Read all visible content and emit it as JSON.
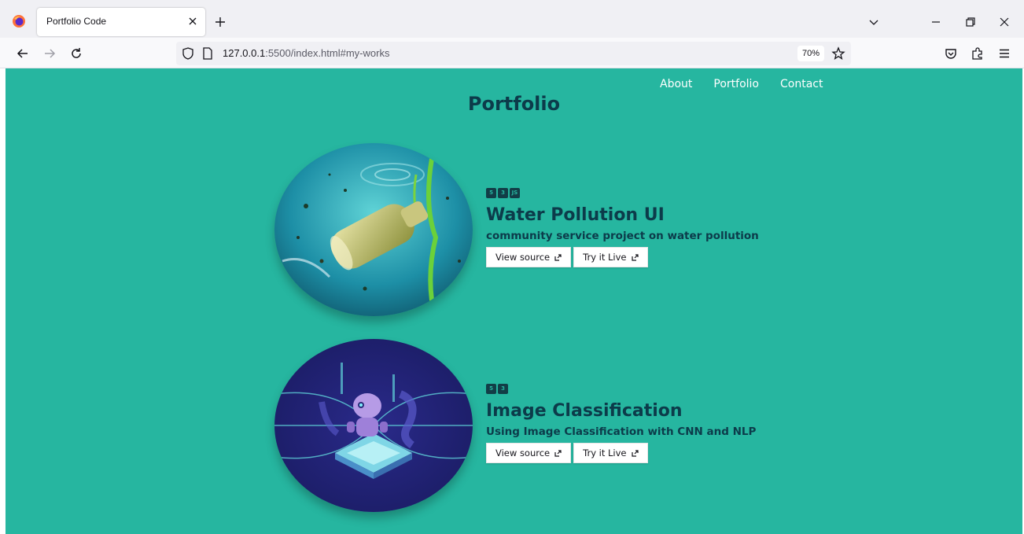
{
  "browser": {
    "tab_title": "Portfolio Code",
    "url_host": "127.0.0.1",
    "url_rest": ":5500/index.html#my-works",
    "zoom": "70%"
  },
  "site": {
    "nav": [
      "About",
      "Portfolio",
      "Contact"
    ],
    "title": "Portfolio"
  },
  "projects": [
    {
      "title": "Water Pollution UI",
      "desc": "community service project on water pollution",
      "tech": [
        "HTML5",
        "CSS3",
        "JS"
      ],
      "buttons": [
        "View source",
        "Try it Live"
      ]
    },
    {
      "title": "Image Classification",
      "desc": "Using Image Classification with CNN and NLP",
      "tech": [
        "HTML5",
        "CSS3"
      ],
      "buttons": [
        "View source",
        "Try it Live"
      ]
    }
  ]
}
